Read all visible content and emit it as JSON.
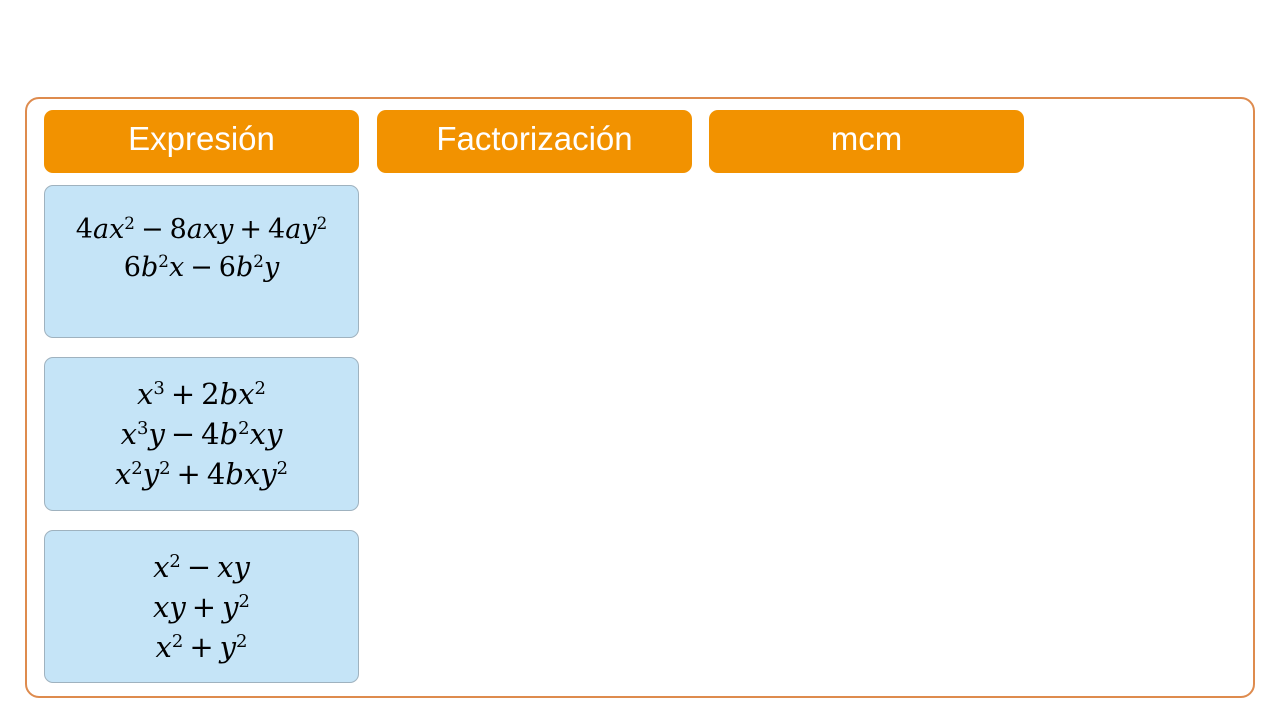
{
  "table": {
    "headers": {
      "expresion": "Expresión",
      "factorizacion": "Factorización",
      "mcm": "mcm"
    },
    "rows": [
      {
        "expressions": [
          "4ax² − 8axy + 4ay²",
          "6b²x − 6b²y"
        ]
      },
      {
        "expressions": [
          "x³ + 2bx²",
          "x³y − 4b²xy",
          "x²y² + 4bxy²"
        ]
      },
      {
        "expressions": [
          "x² − xy",
          "xy + y²",
          "x² + y²"
        ]
      }
    ]
  },
  "colors": {
    "header_bg": "#f29200",
    "cell_bg": "#c5e4f7",
    "frame_border": "#de8b4e"
  }
}
